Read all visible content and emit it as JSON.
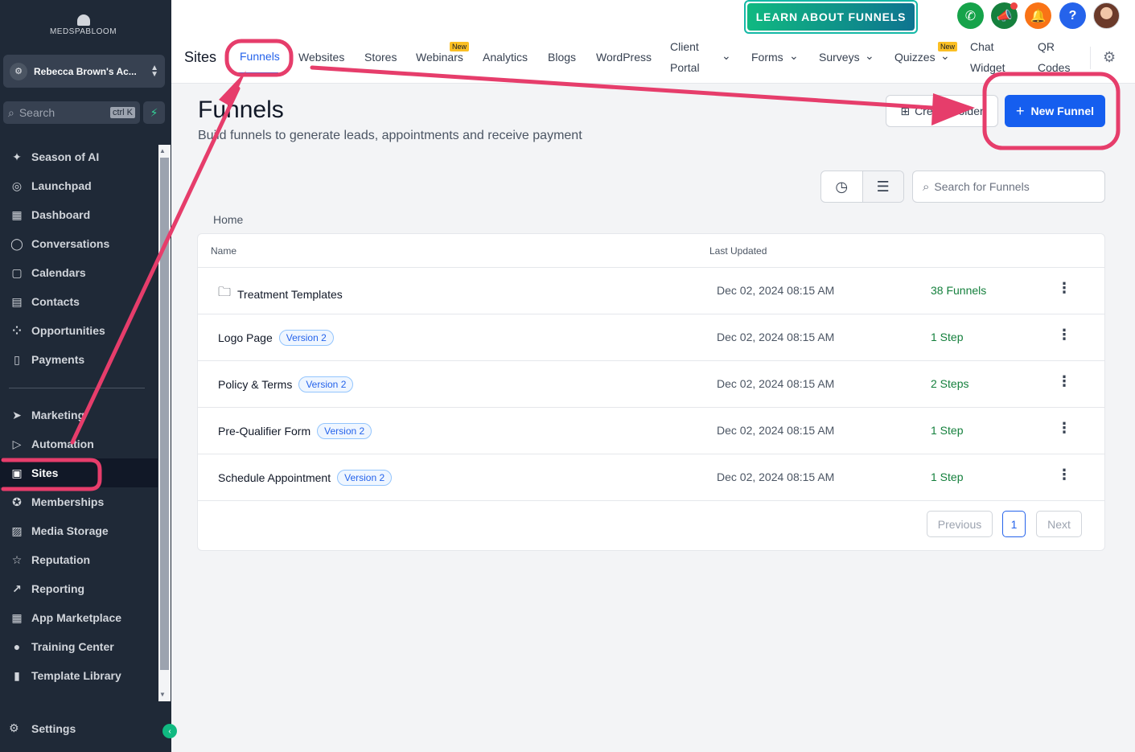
{
  "sidebar": {
    "logo_text": "MEDSPABLOOM",
    "account_name": "Rebecca Brown's Ac...",
    "search_placeholder": "Search",
    "search_shortcut": "ctrl K",
    "items": [
      {
        "label": "Season of AI",
        "icon": "sparkle-icon"
      },
      {
        "label": "Launchpad",
        "icon": "rocket-icon"
      },
      {
        "label": "Dashboard",
        "icon": "grid-icon"
      },
      {
        "label": "Conversations",
        "icon": "chat-icon"
      },
      {
        "label": "Calendars",
        "icon": "calendar-icon"
      },
      {
        "label": "Contacts",
        "icon": "contacts-icon"
      },
      {
        "label": "Opportunities",
        "icon": "opportunities-icon"
      },
      {
        "label": "Payments",
        "icon": "payments-icon"
      }
    ],
    "items2": [
      {
        "label": "Marketing",
        "icon": "send-icon"
      },
      {
        "label": "Automation",
        "icon": "automation-icon"
      },
      {
        "label": "Sites",
        "icon": "sites-icon",
        "active": true
      },
      {
        "label": "Memberships",
        "icon": "badge-icon"
      },
      {
        "label": "Media Storage",
        "icon": "image-icon"
      },
      {
        "label": "Reputation",
        "icon": "star-icon"
      },
      {
        "label": "Reporting",
        "icon": "trend-icon"
      },
      {
        "label": "App Marketplace",
        "icon": "apps-icon"
      },
      {
        "label": "Training Center",
        "icon": "training-icon"
      },
      {
        "label": "Template Library",
        "icon": "template-icon"
      }
    ],
    "settings_label": "Settings"
  },
  "header": {
    "learn_button": "LEARN ABOUT FUNNELS",
    "section_title": "Sites",
    "tabs": {
      "funnels": "Funnels",
      "websites": "Websites",
      "stores": "Stores",
      "webinars": "Webinars",
      "analytics": "Analytics",
      "blogs": "Blogs",
      "wordpress": "WordPress",
      "client_portal_1": "Client",
      "client_portal_2": "Portal",
      "forms": "Forms",
      "surveys": "Surveys",
      "quizzes": "Quizzes",
      "chat_widget_1": "Chat",
      "chat_widget_2": "Widget",
      "qr_codes_1": "QR",
      "qr_codes_2": "Codes"
    },
    "new_badge": "New",
    "help_glyph": "?"
  },
  "main": {
    "title": "Funnels",
    "subtitle": "Build funnels to generate leads, appointments and receive payment",
    "create_folder": "Create Folder",
    "new_funnel": "New Funnel",
    "search_placeholder": "Search for Funnels",
    "breadcrumb": "Home",
    "columns": {
      "name": "Name",
      "last_updated": "Last Updated"
    },
    "rows": [
      {
        "name": "Treatment Templates",
        "version": "",
        "date": "Dec 02, 2024 08:15 AM",
        "steps": "38 Funnels",
        "folder": true
      },
      {
        "name": "Logo Page",
        "version": "Version 2",
        "date": "Dec 02, 2024 08:15 AM",
        "steps": "1 Step"
      },
      {
        "name": "Policy & Terms",
        "version": "Version 2",
        "date": "Dec 02, 2024 08:15 AM",
        "steps": "2 Steps"
      },
      {
        "name": "Pre-Qualifier Form",
        "version": "Version 2",
        "date": "Dec 02, 2024 08:15 AM",
        "steps": "1 Step"
      },
      {
        "name": "Schedule Appointment",
        "version": "Version 2",
        "date": "Dec 02, 2024 08:15 AM",
        "steps": "1 Step"
      }
    ],
    "pagination": {
      "previous": "Previous",
      "current": "1",
      "next": "Next"
    }
  },
  "colors": {
    "accent": "#155eef",
    "annotation": "#e63d6b",
    "sidebar_bg": "#1f2937",
    "success": "#15803d"
  }
}
